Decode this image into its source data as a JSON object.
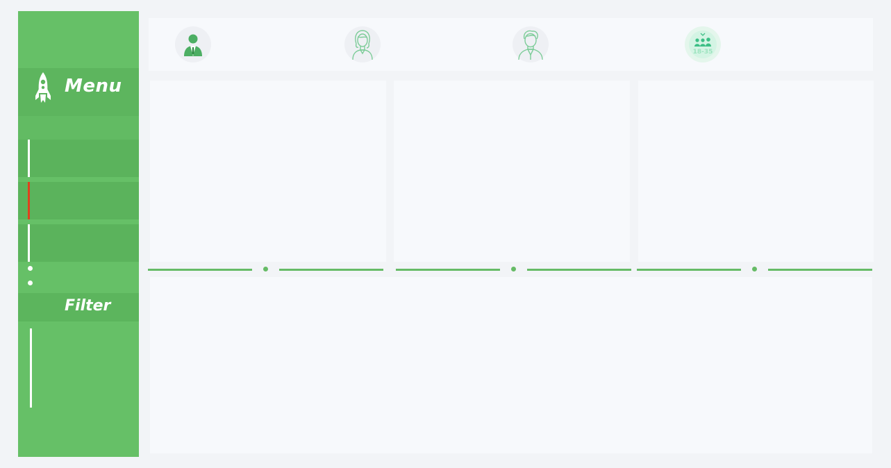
{
  "sidebar": {
    "menu_title": "Menu",
    "filter_title": "Filter",
    "items": [
      {
        "state": "default"
      },
      {
        "state": "active"
      },
      {
        "state": "default"
      }
    ]
  },
  "topbar": {
    "avatars": [
      {
        "icon": "businessman-avatar-icon"
      },
      {
        "icon": "woman-avatar-icon"
      },
      {
        "icon": "man-avatar-icon"
      },
      {
        "icon": "age-group-icon",
        "label": "18-35"
      }
    ]
  },
  "colors": {
    "sidebar": "#66c067",
    "active_indicator": "#e0401e",
    "accent": "#66bb66",
    "panel": "#f7f9fc",
    "background": "#f2f4f7"
  }
}
